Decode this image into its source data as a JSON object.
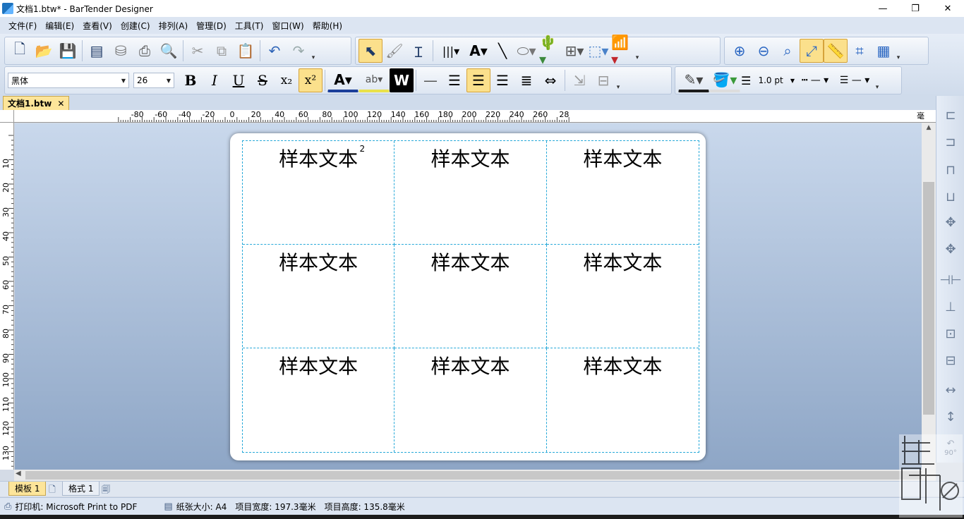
{
  "window": {
    "title": "文档1.btw* - BarTender Designer",
    "minimize": "—",
    "maximize": "❐",
    "close": "✕"
  },
  "menu": [
    "文件(F)",
    "编辑(E)",
    "查看(V)",
    "创建(C)",
    "排列(A)",
    "管理(D)",
    "工具(T)",
    "窗口(W)",
    "帮助(H)"
  ],
  "format_bar": {
    "font_name": "黑体",
    "font_size": "26",
    "line_width": "1.0 pt"
  },
  "doc_tab": {
    "label": "文档1.btw",
    "close": "✕"
  },
  "ruler": {
    "unit": "毫米",
    "top_labels": [
      "-80",
      "-60",
      "-40",
      "-20",
      "0",
      "20",
      "40",
      "60",
      "80",
      "100",
      "120",
      "140",
      "160",
      "180",
      "200",
      "220",
      "240",
      "260",
      "28"
    ],
    "left_labels": [
      "10",
      "20",
      "30",
      "40",
      "50",
      "60",
      "70",
      "80",
      "90",
      "100",
      "110",
      "120",
      "130"
    ]
  },
  "label_cells": [
    {
      "text": "样本文本",
      "sup": "2"
    },
    {
      "text": "样本文本",
      "sup": ""
    },
    {
      "text": "样本文本",
      "sup": ""
    },
    {
      "text": "样本文本",
      "sup": ""
    },
    {
      "text": "样本文本",
      "sup": ""
    },
    {
      "text": "样本文本",
      "sup": ""
    },
    {
      "text": "样本文本",
      "sup": ""
    },
    {
      "text": "样本文本",
      "sup": ""
    },
    {
      "text": "样本文本",
      "sup": ""
    }
  ],
  "sheet_tabs": {
    "template": "模板 1",
    "format": "格式 1"
  },
  "status": {
    "printer": "打印机: Microsoft Print to PDF",
    "paper": "纸张大小: A4",
    "item_width": "项目宽度: 197.3毫米",
    "item_height": "项目高度: 135.8毫米"
  },
  "right_toolbar": {
    "rotate_label": "90°"
  }
}
